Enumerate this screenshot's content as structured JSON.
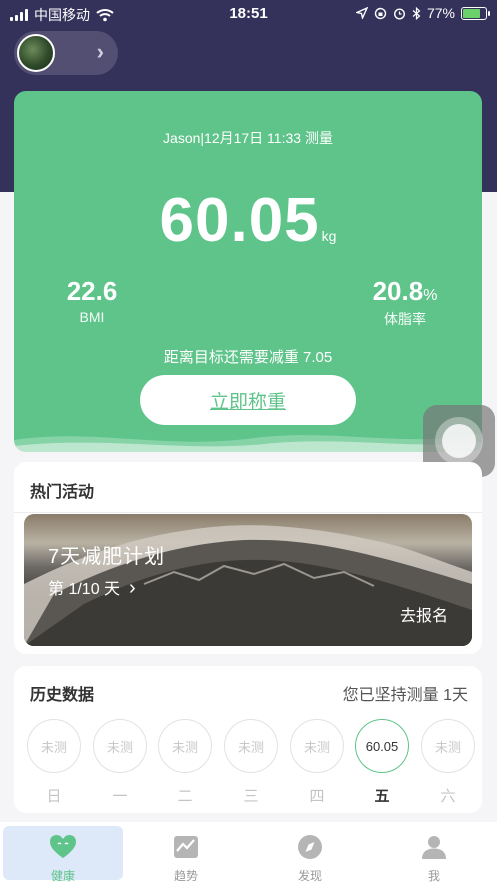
{
  "status_bar": {
    "carrier": "中国移动",
    "time": "18:51",
    "battery": "77%",
    "battery_level": 0.77
  },
  "measurement": {
    "info": "Jason|12月17日 11:33 测量",
    "weight": "60.05",
    "unit": "kg",
    "bmi_value": "22.6",
    "bmi_label": "BMI",
    "body_fat_value": "20.8",
    "body_fat_unit": "%",
    "body_fat_label": "体脂率",
    "goal_text": "距离目标还需要减重 7.05",
    "weigh_now_label": "立即称重"
  },
  "activities": {
    "title": "热门活动",
    "banner_title": "7天减肥计划",
    "banner_progress": "第 1/10 天",
    "banner_chevron": "›",
    "banner_cta": "去报名"
  },
  "history": {
    "title": "历史数据",
    "streak": "您已坚持测量 1天",
    "days": [
      {
        "label": "日",
        "value": "未测"
      },
      {
        "label": "一",
        "value": "未测"
      },
      {
        "label": "二",
        "value": "未测"
      },
      {
        "label": "三",
        "value": "未测"
      },
      {
        "label": "四",
        "value": "未测"
      },
      {
        "label": "五",
        "value": "60.05",
        "active": true
      },
      {
        "label": "六",
        "value": "未测"
      }
    ]
  },
  "tabs": [
    {
      "label": "健康",
      "icon": "heart-icon",
      "active": true
    },
    {
      "label": "趋势",
      "icon": "trend-chart-icon"
    },
    {
      "label": "发现",
      "icon": "compass-icon"
    },
    {
      "label": "我",
      "icon": "person-icon"
    }
  ],
  "colors": {
    "header_bg": "#34315a",
    "accent_green": "#5ec48a",
    "tab_active_bg": "#dde9f9"
  }
}
